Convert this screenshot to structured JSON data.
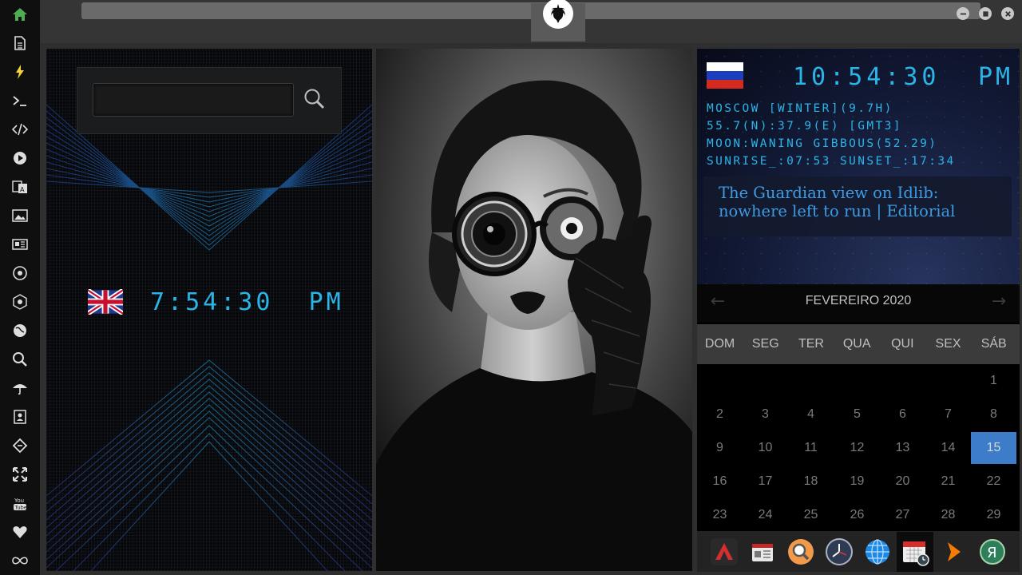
{
  "sidebar": {
    "items": [
      {
        "icon": "home-icon"
      },
      {
        "icon": "document-icon"
      },
      {
        "icon": "lightning-icon"
      },
      {
        "icon": "terminal-icon"
      },
      {
        "icon": "code-icon"
      },
      {
        "icon": "play-icon"
      },
      {
        "icon": "translate-icon"
      },
      {
        "icon": "image-icon"
      },
      {
        "icon": "newspaper-icon"
      },
      {
        "icon": "rebel-icon"
      },
      {
        "icon": "empire-icon"
      },
      {
        "icon": "globe-icon"
      },
      {
        "icon": "search-icon"
      },
      {
        "icon": "umbrella-icon"
      },
      {
        "icon": "contacts-icon"
      },
      {
        "icon": "tag-icon"
      },
      {
        "icon": "expand-icon"
      },
      {
        "icon": "youtube-icon"
      },
      {
        "icon": "heart-icon"
      },
      {
        "icon": "infinity-icon"
      }
    ],
    "accent": "#4caf50"
  },
  "topbar": {
    "logo_icon": "rebel-alliance-icon"
  },
  "search": {
    "value": "",
    "placeholder": ""
  },
  "uk_clock": {
    "time": "7:54:30",
    "ampm": "PM"
  },
  "ru_clock": {
    "time": "10:54:30",
    "ampm": "PM",
    "location": "MOSCOW [WINTER](9.7H)",
    "coords": "55.7(N):37.9(E) [GMT3]",
    "moon": "MOON:WANING GIBBOUS(52.29)",
    "sun": "SUNRISE_:07:53 SUNSET_:17:34"
  },
  "news": {
    "headline": "The Guardian view on Idlib: nowhere left to run | Editorial"
  },
  "calendar": {
    "month": "FEVEREIRO 2020",
    "weekdays": [
      "DOM",
      "SEG",
      "TER",
      "QUA",
      "QUI",
      "SEX",
      "SÁB"
    ],
    "days": [
      "1",
      "2",
      "3",
      "4",
      "5",
      "6",
      "7",
      "8",
      "9",
      "10",
      "11",
      "12",
      "13",
      "14",
      "15",
      "16",
      "17",
      "18",
      "19",
      "20",
      "21",
      "22",
      "23",
      "24",
      "25",
      "26",
      "27",
      "28",
      "29"
    ],
    "today": "15",
    "today_color": "#3d7cc9"
  },
  "dock": {
    "items": [
      "arch-icon",
      "news-reader-icon",
      "search-app-icon",
      "clock-icon",
      "browser-globe-icon",
      "calendar-icon",
      "forward-arrow-icon",
      "yandex-icon"
    ]
  },
  "colors": {
    "digital_blue": "#2bb4e8",
    "news_blue": "#3d9be3"
  }
}
